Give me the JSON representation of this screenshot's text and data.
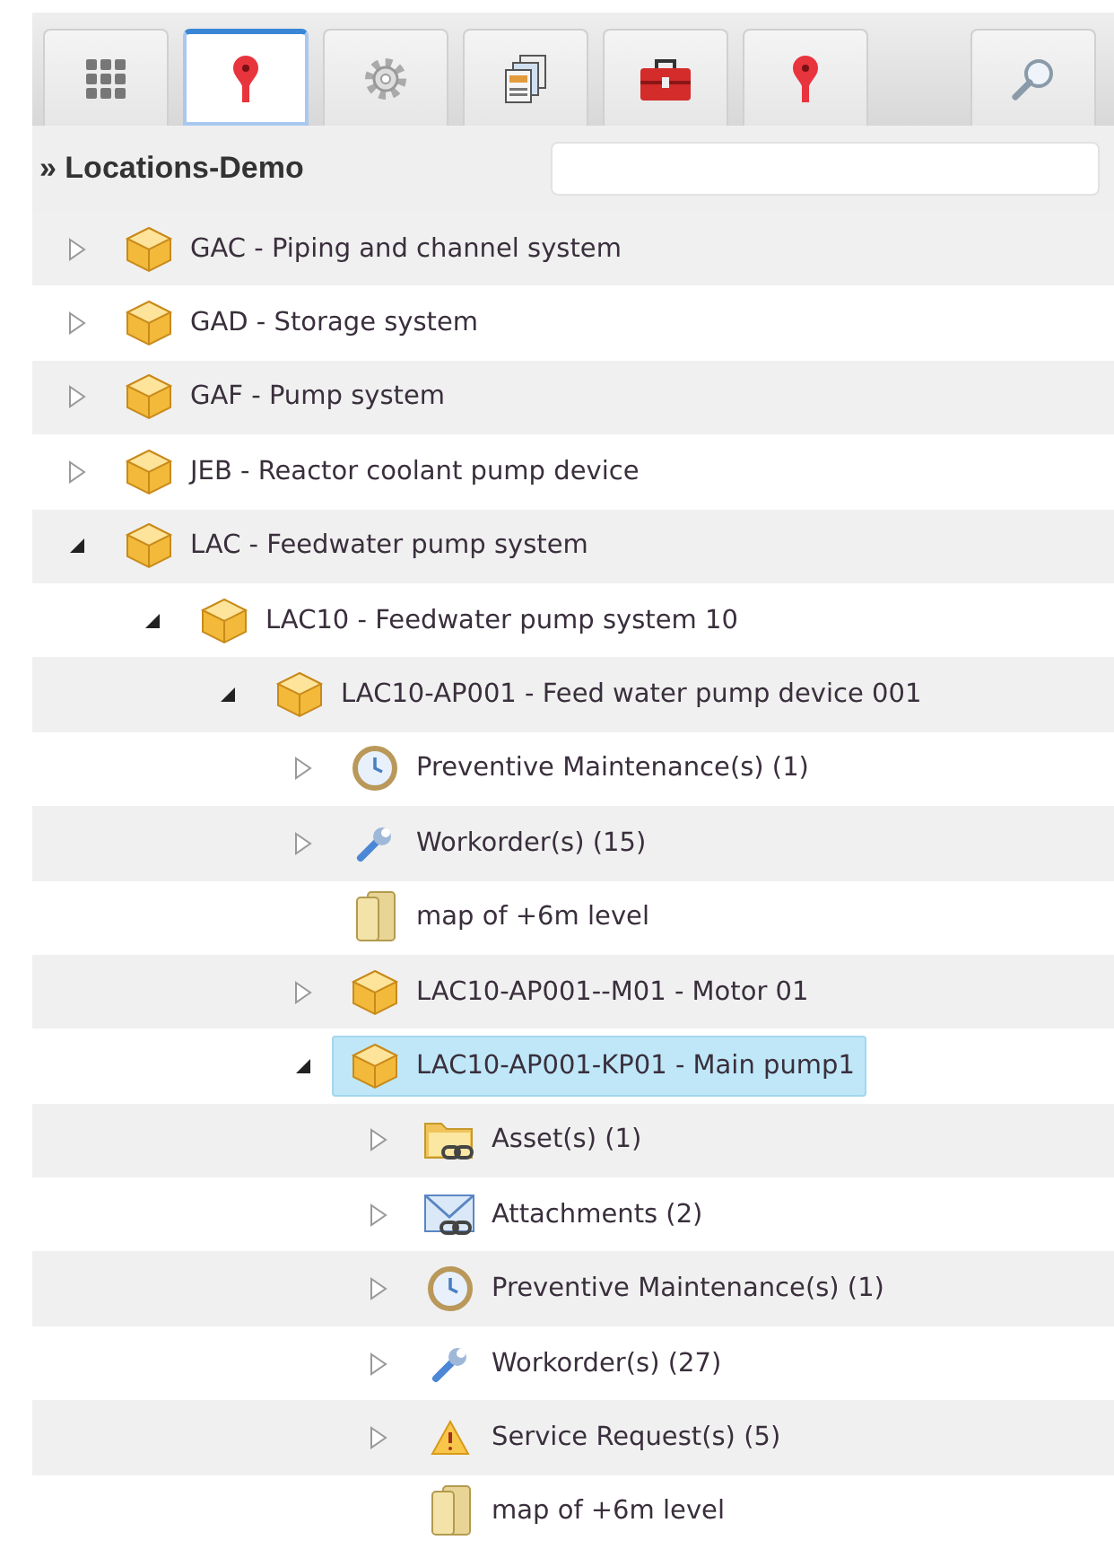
{
  "toolbar": {
    "tabs": [
      {
        "kind": "grid",
        "selected": false
      },
      {
        "kind": "pin",
        "selected": true
      },
      {
        "kind": "gear",
        "selected": false
      },
      {
        "kind": "documents",
        "selected": false
      },
      {
        "kind": "toolbox",
        "selected": false
      },
      {
        "kind": "pin",
        "selected": false
      }
    ],
    "search_button": {
      "kind": "search"
    }
  },
  "header": {
    "title": "» Locations-Demo"
  },
  "tree": [
    {
      "label": "GAC - Piping and channel system",
      "kind": "box",
      "expanded": false,
      "selected": false
    },
    {
      "label": "GAD - Storage system",
      "kind": "box",
      "expanded": false,
      "selected": false
    },
    {
      "label": "GAF - Pump system",
      "kind": "box",
      "expanded": false,
      "selected": false
    },
    {
      "label": "JEB - Reactor coolant pump device",
      "kind": "box",
      "expanded": false,
      "selected": false
    },
    {
      "label": "LAC - Feedwater pump system",
      "kind": "box",
      "expanded": true,
      "selected": false,
      "children": [
        {
          "label": "LAC10 - Feedwater pump system 10",
          "kind": "box",
          "expanded": true,
          "selected": false,
          "children": [
            {
              "label": "LAC10-AP001 - Feed water pump device 001",
              "kind": "box",
              "expanded": true,
              "selected": false,
              "children": [
                {
                  "label": "Preventive Maintenance(s) (1)",
                  "kind": "clock",
                  "expanded": false,
                  "selected": false
                },
                {
                  "label": "Workorder(s) (15)",
                  "kind": "wrench",
                  "expanded": false,
                  "selected": false
                },
                {
                  "label": "map of +6m level",
                  "kind": "document",
                  "selected": false
                },
                {
                  "label": "LAC10-AP001--M01 - Motor 01",
                  "kind": "box",
                  "expanded": false,
                  "selected": false
                },
                {
                  "label": "LAC10-AP001-KP01 - Main pump1",
                  "kind": "box",
                  "expanded": true,
                  "selected": true,
                  "children": [
                    {
                      "label": "Asset(s) (1)",
                      "kind": "folder-link",
                      "expanded": false,
                      "selected": false
                    },
                    {
                      "label": "Attachments (2)",
                      "kind": "mail-link",
                      "expanded": false,
                      "selected": false
                    },
                    {
                      "label": "Preventive Maintenance(s) (1)",
                      "kind": "clock",
                      "expanded": false,
                      "selected": false
                    },
                    {
                      "label": "Workorder(s) (27)",
                      "kind": "wrench",
                      "expanded": false,
                      "selected": false
                    },
                    {
                      "label": "Service Request(s) (5)",
                      "kind": "warning",
                      "expanded": false,
                      "selected": false
                    },
                    {
                      "label": "map of +6m level",
                      "kind": "document",
                      "selected": false
                    }
                  ]
                }
              ]
            }
          ]
        }
      ]
    }
  ]
}
